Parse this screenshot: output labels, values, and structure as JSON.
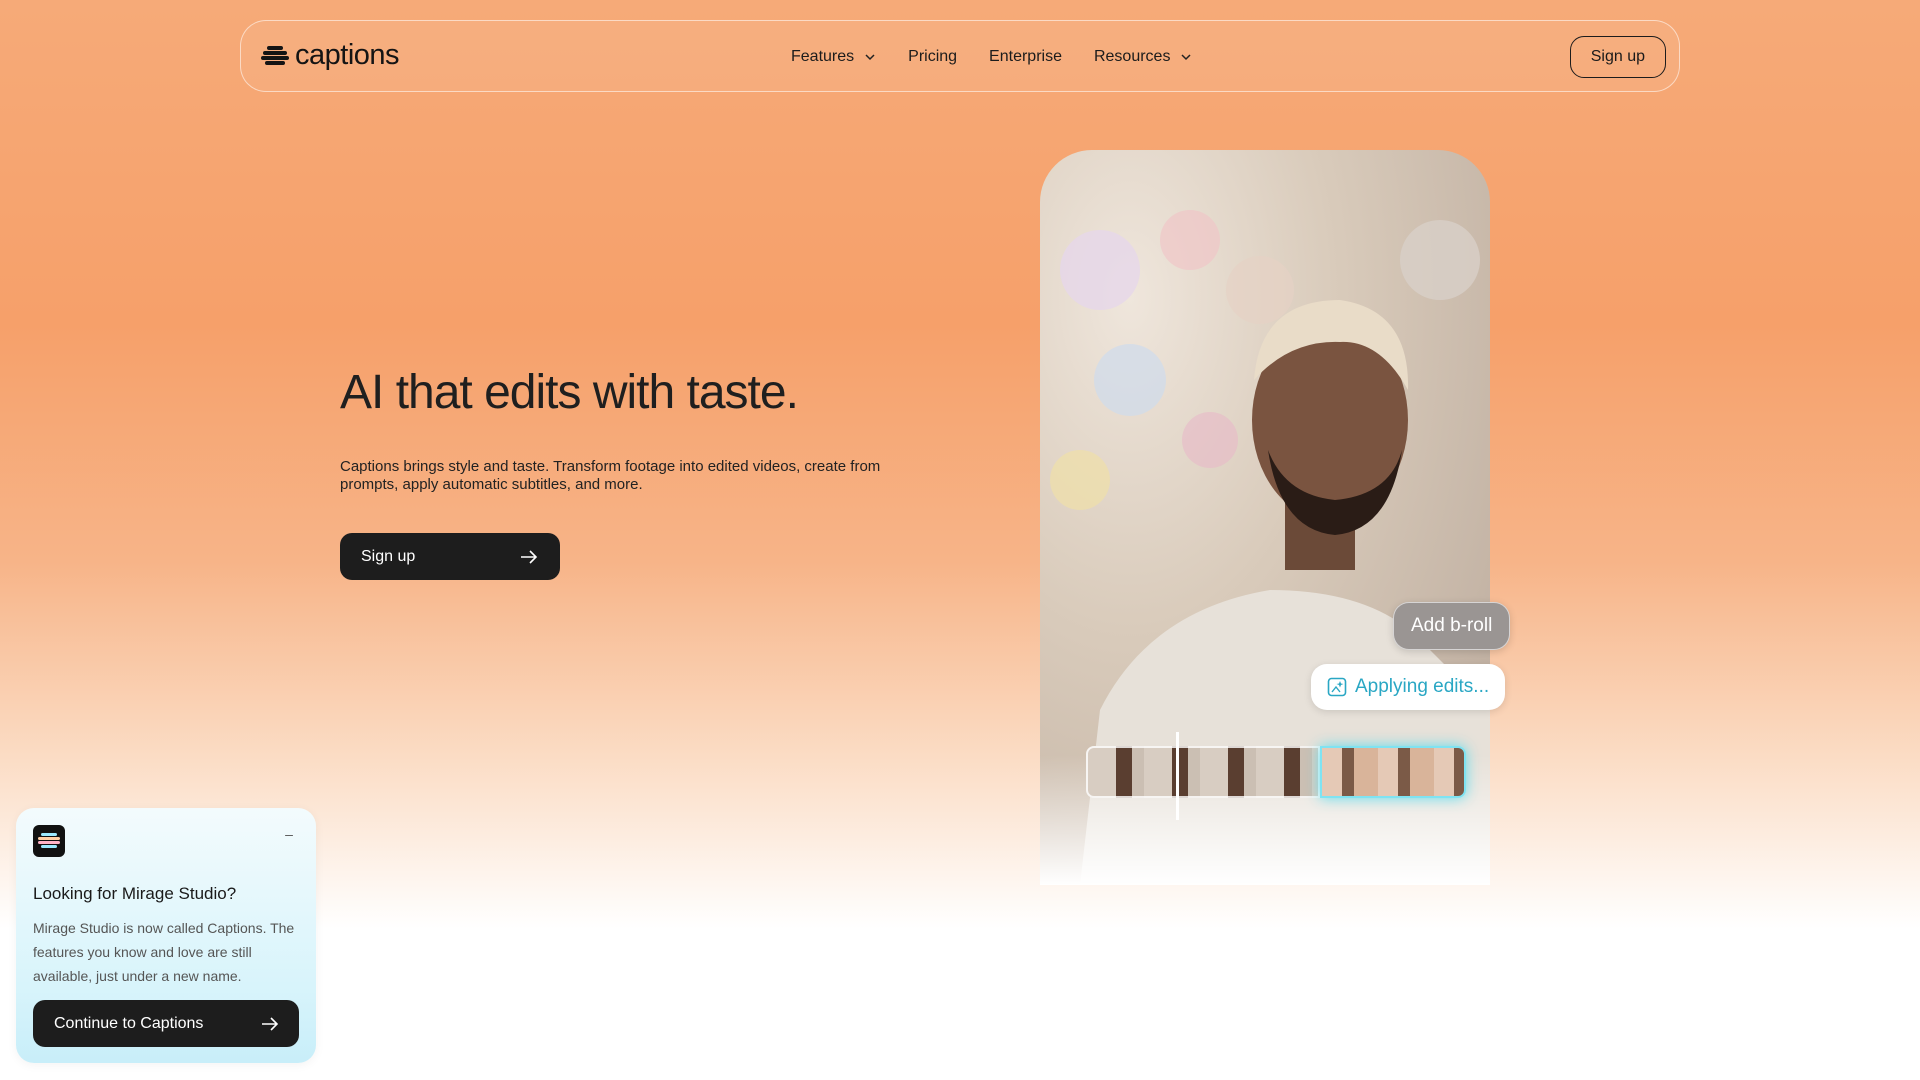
{
  "nav": {
    "logo_text": "captions",
    "links": [
      {
        "label": "Features",
        "has_dropdown": true
      },
      {
        "label": "Pricing",
        "has_dropdown": false
      },
      {
        "label": "Enterprise",
        "has_dropdown": false
      },
      {
        "label": "Resources",
        "has_dropdown": true
      }
    ],
    "signup_label": "Sign up"
  },
  "hero": {
    "title": "AI that edits with taste.",
    "subtitle": "Captions brings style and taste. Transform footage into edited videos, create from prompts, apply automatic subtitles, and more.",
    "cta_label": "Sign up",
    "cta_icon": "arrow-right-icon"
  },
  "media": {
    "chip_broll": "Add b-roll",
    "chip_applying": "Applying edits...",
    "chip_applying_icon": "sparkle-image-icon"
  },
  "popup": {
    "title": "Looking for Mirage Studio?",
    "body": "Mirage Studio is now called Captions. The features you know and love are still available, just under a new name.",
    "button_label": "Continue to Captions",
    "minimize_icon": "minimize-icon"
  },
  "colors": {
    "accent_orange": "#f6a06a",
    "dark_button": "#1d1d1d",
    "applying_text": "#2aa7c4",
    "popup_bg": "#d8f4fb"
  }
}
